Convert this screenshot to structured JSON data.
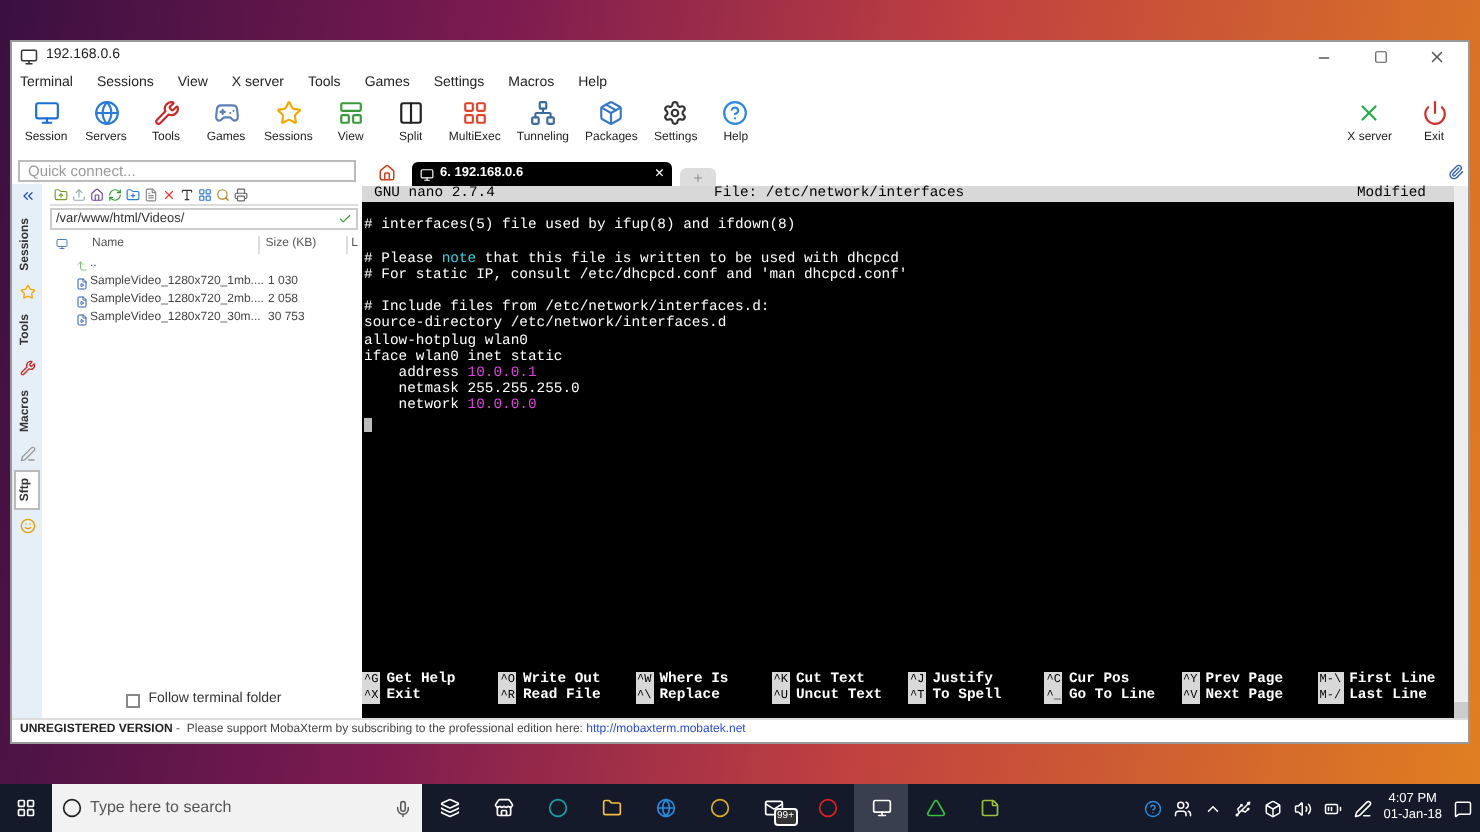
{
  "window": {
    "title": "192.168.0.6"
  },
  "menu": [
    "Terminal",
    "Sessions",
    "View",
    "X server",
    "Tools",
    "Games",
    "Settings",
    "Macros",
    "Help"
  ],
  "toolbar": [
    {
      "label": "Session"
    },
    {
      "label": "Servers"
    },
    {
      "label": "Tools"
    },
    {
      "label": "Games"
    },
    {
      "label": "Sessions"
    },
    {
      "label": "View"
    },
    {
      "label": "Split"
    },
    {
      "label": "MultiExec"
    },
    {
      "label": "Tunneling"
    },
    {
      "label": "Packages"
    },
    {
      "label": "Settings"
    },
    {
      "label": "Help"
    }
  ],
  "toolbar_right": [
    {
      "label": "X server"
    },
    {
      "label": "Exit"
    }
  ],
  "quick_connect": {
    "placeholder": "Quick connect..."
  },
  "side_tabs": [
    {
      "label": "Sessions",
      "selected": false
    },
    {
      "label": "Tools",
      "selected": false
    },
    {
      "label": "Macros",
      "selected": false
    },
    {
      "label": "Sftp",
      "selected": true
    }
  ],
  "sftp": {
    "path": "/var/www/html/Videos/",
    "columns": [
      "Name",
      "Size (KB)",
      "L"
    ],
    "rows": [
      {
        "name": "..",
        "size": "",
        "kind": "parent"
      },
      {
        "name": "SampleVideo_1280x720_1mb....",
        "size": "1 030",
        "kind": "file"
      },
      {
        "name": "SampleVideo_1280x720_2mb....",
        "size": "2 058",
        "kind": "file"
      },
      {
        "name": "SampleVideo_1280x720_30m...",
        "size": "30 753",
        "kind": "file"
      }
    ],
    "follow_terminal_folder": {
      "label": "Follow terminal folder",
      "checked": false
    }
  },
  "terminal_tabs": [
    {
      "label": "6. 192.168.0.6",
      "selected": true,
      "close": "×"
    }
  ],
  "nano": {
    "version": "GNU nano 2.7.4",
    "file": "File: /etc/network/interfaces",
    "status": "Modified",
    "lines": [
      {
        "gap_before": false,
        "parts": [
          {
            "text": "# interfaces(5) file used by ifup(8) and ifdown(8)",
            "kind": "plain"
          }
        ]
      },
      {
        "gap_before": true,
        "parts": [
          {
            "text": "# Please ",
            "kind": "plain"
          },
          {
            "text": "note",
            "kind": "keyword"
          },
          {
            "text": " that this file is written to be used with dhcpcd",
            "kind": "plain"
          }
        ]
      },
      {
        "gap_before": false,
        "parts": [
          {
            "text": "# For static IP, consult /etc/dhcpcd.conf and 'man dhcpcd.conf'",
            "kind": "plain"
          }
        ]
      },
      {
        "gap_before": true,
        "parts": [
          {
            "text": "# Include files from /etc/network/interfaces.d:",
            "kind": "plain"
          }
        ]
      },
      {
        "gap_before": false,
        "parts": [
          {
            "text": "source-directory /etc/network/interfaces.d",
            "kind": "plain"
          }
        ]
      },
      {
        "gap_before": false,
        "parts": [
          {
            "text": "allow-hotplug wlan0",
            "kind": "plain"
          }
        ]
      },
      {
        "gap_before": false,
        "parts": [
          {
            "text": "iface wlan0 inet static",
            "kind": "plain"
          }
        ]
      },
      {
        "gap_before": false,
        "parts": [
          {
            "text": "    address ",
            "kind": "plain"
          },
          {
            "text": "10.0.0.1",
            "kind": "value"
          }
        ]
      },
      {
        "gap_before": false,
        "parts": [
          {
            "text": "    netmask 255.255.255.0",
            "kind": "plain"
          }
        ]
      },
      {
        "gap_before": false,
        "parts": [
          {
            "text": "    network ",
            "kind": "plain"
          },
          {
            "text": "10.0.0.0",
            "kind": "value"
          }
        ]
      }
    ],
    "shortcuts": [
      [
        {
          "key": "^G",
          "label": "Get Help"
        },
        {
          "key": "^O",
          "label": "Write Out"
        },
        {
          "key": "^W",
          "label": "Where Is"
        },
        {
          "key": "^K",
          "label": "Cut Text"
        },
        {
          "key": "^J",
          "label": "Justify"
        },
        {
          "key": "^C",
          "label": "Cur Pos"
        },
        {
          "key": "^Y",
          "label": "Prev Page"
        },
        {
          "key": "M-\\",
          "label": "First Line"
        }
      ],
      [
        {
          "key": "^X",
          "label": "Exit"
        },
        {
          "key": "^R",
          "label": "Read File"
        },
        {
          "key": "^\\",
          "label": "Replace"
        },
        {
          "key": "^U",
          "label": "Uncut Text"
        },
        {
          "key": "^T",
          "label": "To Spell"
        },
        {
          "key": "^_",
          "label": "Go To Line"
        },
        {
          "key": "^V",
          "label": "Next Page"
        },
        {
          "key": "M-/",
          "label": "Last Line"
        }
      ]
    ]
  },
  "status_bar": {
    "label": "UNREGISTERED VERSION",
    "text": " -  Please support MobaXterm by subscribing to the professional edition here: ",
    "link": "http://mobaxterm.mobatek.net"
  },
  "taskbar": {
    "search": {
      "placeholder": "Type here to search"
    },
    "mail_badge": "99+",
    "time": "4:07 PM",
    "date": "01-Jan-18"
  }
}
